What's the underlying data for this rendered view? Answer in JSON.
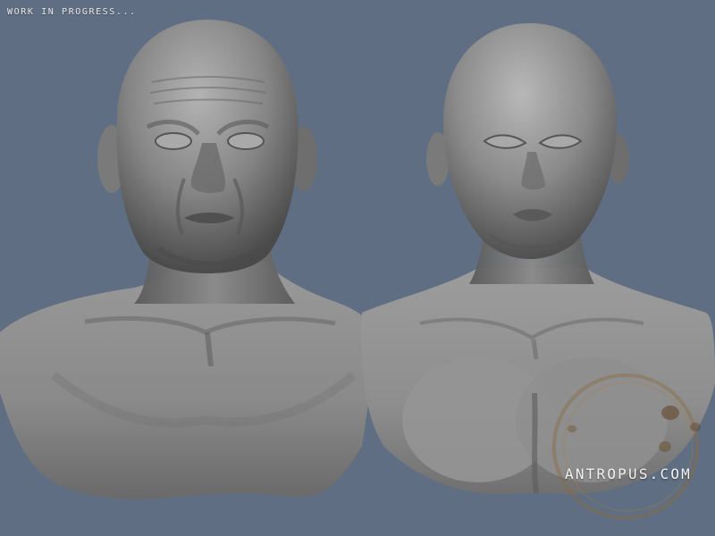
{
  "overlay": {
    "status_text": "WORK IN PROGRESS...",
    "watermark_text": "ANTROPUS.COM"
  },
  "scene": {
    "subjects": [
      "male-bust",
      "female-bust"
    ],
    "icons": [
      "coffee-stain-icon"
    ]
  },
  "colors": {
    "background": "#5f6e82",
    "clay": "#7c7c7c",
    "clay_light": "#b7b7b7",
    "clay_dark": "#3b3b3b",
    "stain": "#8a6a3a"
  }
}
